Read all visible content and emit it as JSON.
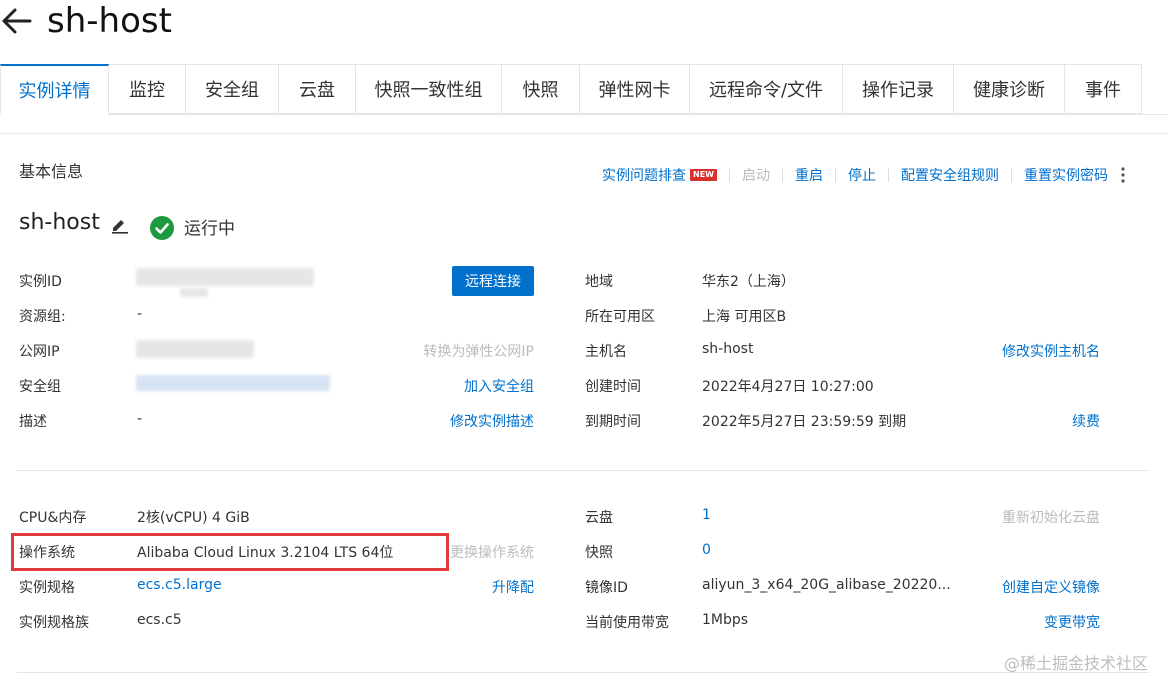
{
  "header": {
    "title": "sh-host"
  },
  "tabs": [
    {
      "label": "实例详情",
      "active": true
    },
    {
      "label": "监控"
    },
    {
      "label": "安全组"
    },
    {
      "label": "云盘"
    },
    {
      "label": "快照一致性组"
    },
    {
      "label": "快照"
    },
    {
      "label": "弹性网卡"
    },
    {
      "label": "远程命令/文件"
    },
    {
      "label": "操作记录"
    },
    {
      "label": "健康诊断"
    },
    {
      "label": "事件"
    }
  ],
  "basic": {
    "title": "基本信息",
    "actions": {
      "troubleshoot": "实例问题排查",
      "new_badge": "NEW",
      "start": "启动",
      "restart": "重启",
      "stop": "停止",
      "config_sg": "配置安全组规则",
      "reset_pwd": "重置实例密码"
    },
    "host_name": "sh-host",
    "status": "运行中"
  },
  "left": {
    "instance_id_label": "实例ID",
    "remote_btn": "远程连接",
    "resource_group_label": "资源组:",
    "resource_group_value": "-",
    "public_ip_label": "公网IP",
    "public_ip_action": "转换为弹性公网IP",
    "sg_label": "安全组",
    "sg_action": "加入安全组",
    "desc_label": "描述",
    "desc_value": "-",
    "desc_action": "修改实例描述",
    "cpu_label": "CPU&内存",
    "cpu_value": "2核(vCPU) 4 GiB",
    "os_label": "操作系统",
    "os_value": "Alibaba Cloud Linux 3.2104 LTS 64位",
    "os_action": "更换操作系统",
    "spec_label": "实例规格",
    "spec_value": "ecs.c5.large",
    "spec_action": "升降配",
    "family_label": "实例规格族",
    "family_value": "ecs.c5"
  },
  "right": {
    "region_label": "地域",
    "region_value": "华东2（上海）",
    "zone_label": "所在可用区",
    "zone_value": "上海 可用区B",
    "hostname_label": "主机名",
    "hostname_value": "sh-host",
    "hostname_action": "修改实例主机名",
    "created_label": "创建时间",
    "created_value": "2022年4月27日 10:27:00",
    "expire_label": "到期时间",
    "expire_value": "2022年5月27日 23:59:59 到期",
    "expire_action": "续费",
    "disk_label": "云盘",
    "disk_value": "1",
    "disk_action": "重新初始化云盘",
    "snapshot_label": "快照",
    "snapshot_value": "0",
    "image_label": "镜像ID",
    "image_value": "aliyun_3_x64_20G_alibase_20220...",
    "image_action": "创建自定义镜像",
    "bw_label": "当前使用带宽",
    "bw_value": "1Mbps",
    "bw_action": "变更带宽"
  },
  "watermark": "@稀土掘金技术社区"
}
